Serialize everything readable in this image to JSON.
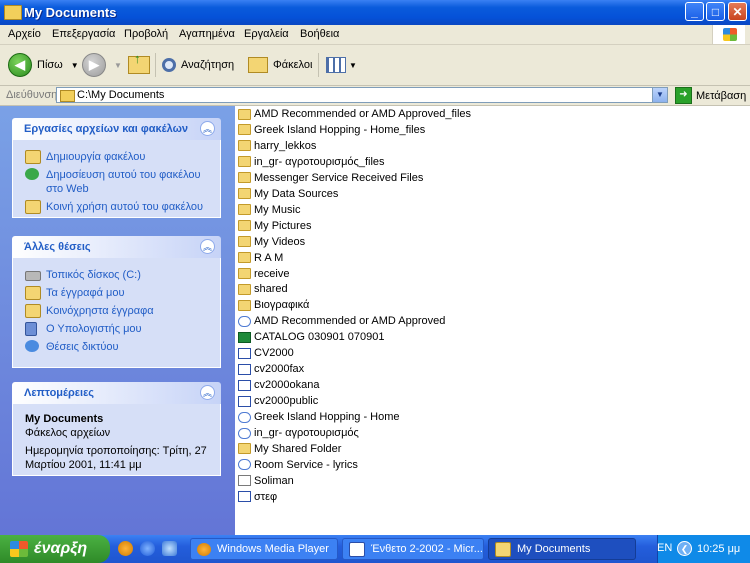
{
  "window": {
    "title": "My Documents"
  },
  "menu": [
    "Αρχείο",
    "Επεξεργασία",
    "Προβολή",
    "Αγαπημένα",
    "Εργαλεία",
    "Βοήθεια"
  ],
  "toolbar": {
    "back": "Πίσω",
    "search": "Αναζήτηση",
    "folders": "Φάκελοι"
  },
  "address": {
    "label": "Διεύθυνση",
    "value": "C:\\My Documents",
    "go": "Μετάβαση"
  },
  "tasks": {
    "title": "Εργασίες αρχείων και φακέλων",
    "items": [
      "Δημιουργία φακέλου",
      "Δημοσίευση αυτού του φακέλου στο Web",
      "Κοινή χρήση αυτού του φακέλου"
    ]
  },
  "places": {
    "title": "Άλλες θέσεις",
    "items": [
      "Τοπικός δίσκος (C:)",
      "Τα έγγραφά μου",
      "Κοινόχρηστα έγγραφα",
      "Ο Υπολογιστής μου",
      "Θέσεις δικτύου"
    ]
  },
  "details": {
    "title": "Λεπτομέρειες",
    "name": "My Documents",
    "type": "Φάκελος αρχείων",
    "modified": "Ημερομηνία τροποποίησης: Τρίτη, 27 Μαρτίου 2001, 11:41 μμ"
  },
  "files": [
    {
      "name": "AMD Recommended or AMD Approved_files",
      "icon": "folder"
    },
    {
      "name": "Greek Island Hopping - Home_files",
      "icon": "folder"
    },
    {
      "name": "harry_lekkos",
      "icon": "folder"
    },
    {
      "name": "in_gr- αγροτουρισμός_files",
      "icon": "folder"
    },
    {
      "name": "Messenger Service Received Files",
      "icon": "folder"
    },
    {
      "name": "My Data Sources",
      "icon": "folder"
    },
    {
      "name": "My Music",
      "icon": "folder"
    },
    {
      "name": "My Pictures",
      "icon": "folder"
    },
    {
      "name": "My Videos",
      "icon": "folder"
    },
    {
      "name": "R A M",
      "icon": "folder"
    },
    {
      "name": "receive",
      "icon": "folder"
    },
    {
      "name": "shared",
      "icon": "folder"
    },
    {
      "name": "Βιογραφικά",
      "icon": "folder"
    },
    {
      "name": "AMD Recommended or AMD Approved",
      "icon": "html"
    },
    {
      "name": "CATALOG 030901 070901",
      "icon": "excel"
    },
    {
      "name": "CV2000",
      "icon": "word"
    },
    {
      "name": "cv2000fax",
      "icon": "word"
    },
    {
      "name": "cv2000okana",
      "icon": "word"
    },
    {
      "name": "cv2000public",
      "icon": "word"
    },
    {
      "name": "Greek Island Hopping - Home",
      "icon": "html"
    },
    {
      "name": "in_gr- αγροτουρισμός",
      "icon": "html"
    },
    {
      "name": "My Shared Folder",
      "icon": "folder"
    },
    {
      "name": "Room Service - lyrics",
      "icon": "html"
    },
    {
      "name": "Soliman",
      "icon": "txt"
    },
    {
      "name": "στεφ",
      "icon": "word"
    }
  ],
  "taskbar": {
    "start": "έναρξη",
    "items": [
      "Windows Media Player",
      "Ένθετο 2-2002 - Micr...",
      "My Documents"
    ],
    "lang": "EN",
    "clock": "10:25 μμ"
  }
}
